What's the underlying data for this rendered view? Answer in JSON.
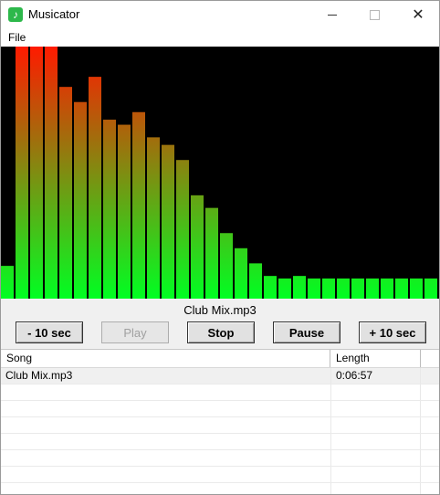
{
  "window": {
    "title": "Musicator",
    "app_icon": "music-note-icon"
  },
  "menu": {
    "file_label": "File"
  },
  "visualizer": {
    "levels": [
      0.13,
      1.0,
      1.0,
      1.0,
      0.84,
      0.78,
      0.88,
      0.71,
      0.69,
      0.74,
      0.64,
      0.61,
      0.55,
      0.41,
      0.36,
      0.26,
      0.2,
      0.14,
      0.09,
      0.08,
      0.09,
      0.08,
      0.08,
      0.08,
      0.08,
      0.08,
      0.08,
      0.08,
      0.08,
      0.08
    ],
    "colors": {
      "low": "#00ff22",
      "high": "#ff1a00",
      "background": "#000000"
    }
  },
  "now_playing": "Club Mix.mp3",
  "controls": {
    "back_label": "- 10 sec",
    "play_label": "Play",
    "stop_label": "Stop",
    "pause_label": "Pause",
    "forward_label": "+ 10 sec"
  },
  "playlist": {
    "columns": {
      "song": "Song",
      "length": "Length"
    },
    "rows": [
      {
        "song": "Club Mix.mp3",
        "length": "0:06:57"
      }
    ]
  }
}
